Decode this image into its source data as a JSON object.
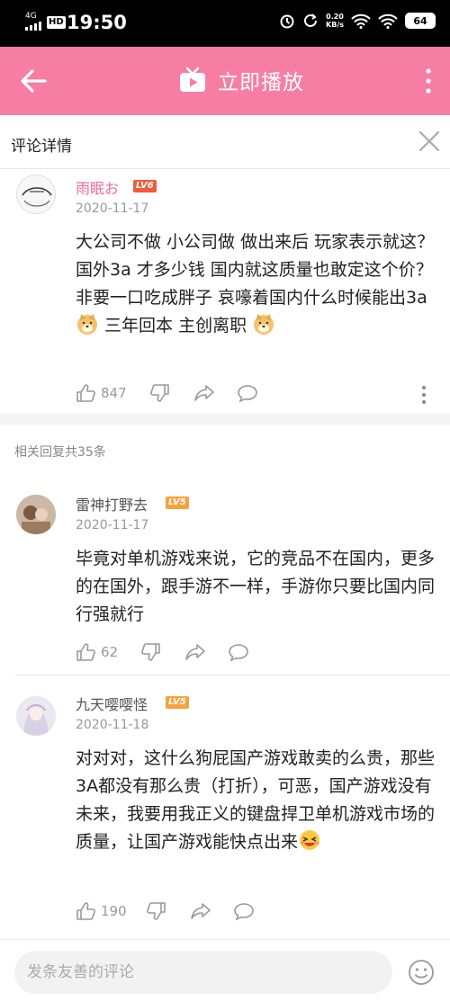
{
  "status_bar": {
    "network": "4G",
    "hd": "HD",
    "time": "19:50",
    "speed_value": "0.20",
    "speed_unit": "KB/s",
    "battery": "64"
  },
  "header": {
    "title": "立即播放"
  },
  "subheader": {
    "title": "评论详情"
  },
  "main_comment": {
    "user": "雨眠お",
    "level": "LV6",
    "date": "2020-11-17",
    "text_part1": "大公司不做  小公司做 做出来后  玩家表示就这？ 国外3a  才多少钱  国内就这质量也敢定这个价？  非要一口吃成胖子  哀嚎着国内什么时候能出3a",
    "text_part2": "  三年回本  主创离职",
    "likes": "847",
    "user_color": "#f06b9a"
  },
  "reply_count": "相关回复共35条",
  "replies": [
    {
      "user": "雷神打野去",
      "level": "LV5",
      "date": "2020-11-17",
      "text": "毕竟对单机游戏来说，它的竞品不在国内，更多的在国外，跟手游不一样，手游你只要比国内同行强就行",
      "likes": "62"
    },
    {
      "user": "九天嘤嘤怪",
      "level": "LV5",
      "date": "2020-11-18",
      "text": "对对对，这什么狗屁国产游戏敢卖的么贵，那些3A都没有那么贵（打折），可恶，国产游戏没有未来，我要用我正义的键盘捍卫单机游戏市场的质量，让国产游戏能快点出来",
      "likes": "190"
    }
  ],
  "bottom": {
    "placeholder": "发条友善的评论"
  },
  "icons": {
    "back": "back-arrow-icon",
    "tv": "tv-icon",
    "more": "more-vertical-icon",
    "close": "close-icon",
    "like": "thumb-up-icon",
    "dislike": "thumb-down-icon",
    "share": "share-icon",
    "reply": "comment-icon",
    "emoji": "emoji-icon"
  },
  "colors": {
    "header_bg": "#f77ea3",
    "level_lv6": "#f15b38",
    "level_lv5": "#f7a23b"
  }
}
